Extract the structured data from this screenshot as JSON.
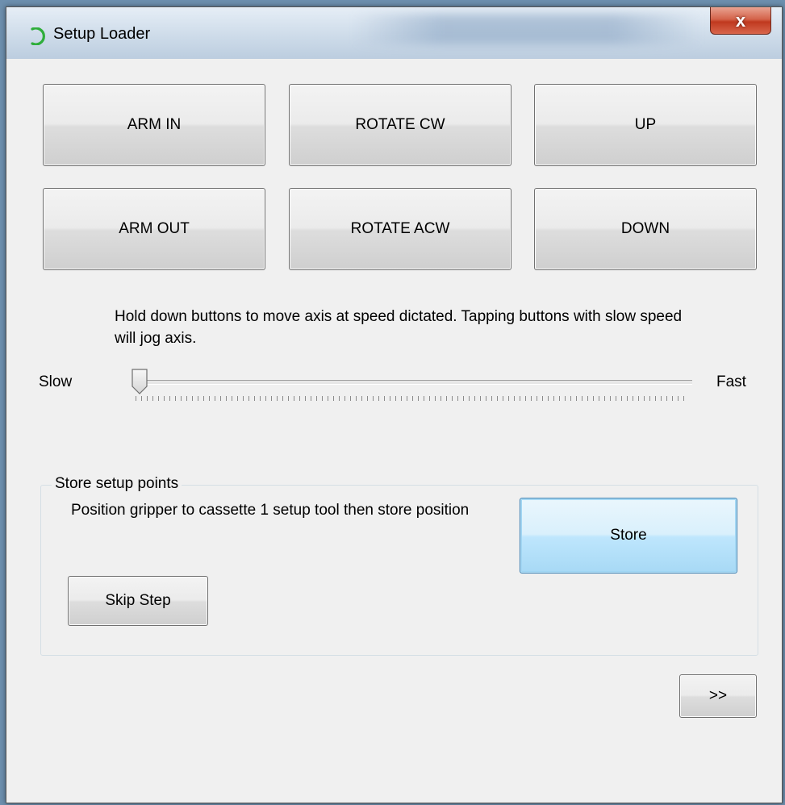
{
  "window": {
    "title": "Setup Loader",
    "close_glyph": "x",
    "accent": "#3c7fb1",
    "close_color": "#c0391f"
  },
  "jog_buttons": [
    {
      "label": "ARM IN"
    },
    {
      "label": "ROTATE CW"
    },
    {
      "label": "UP"
    },
    {
      "label": "ARM OUT"
    },
    {
      "label": "ROTATE ACW"
    },
    {
      "label": "DOWN"
    }
  ],
  "hint": "Hold down buttons to move axis at speed dictated. Tapping buttons with slow speed will jog axis.",
  "speed": {
    "min_label": "Slow",
    "max_label": "Fast",
    "value_fraction": 0.0
  },
  "store_group": {
    "legend": "Store setup points",
    "instruction": "Position gripper to cassette 1 setup tool then store position",
    "store_label": "Store",
    "skip_label": "Skip Step"
  },
  "next_label": ">>"
}
